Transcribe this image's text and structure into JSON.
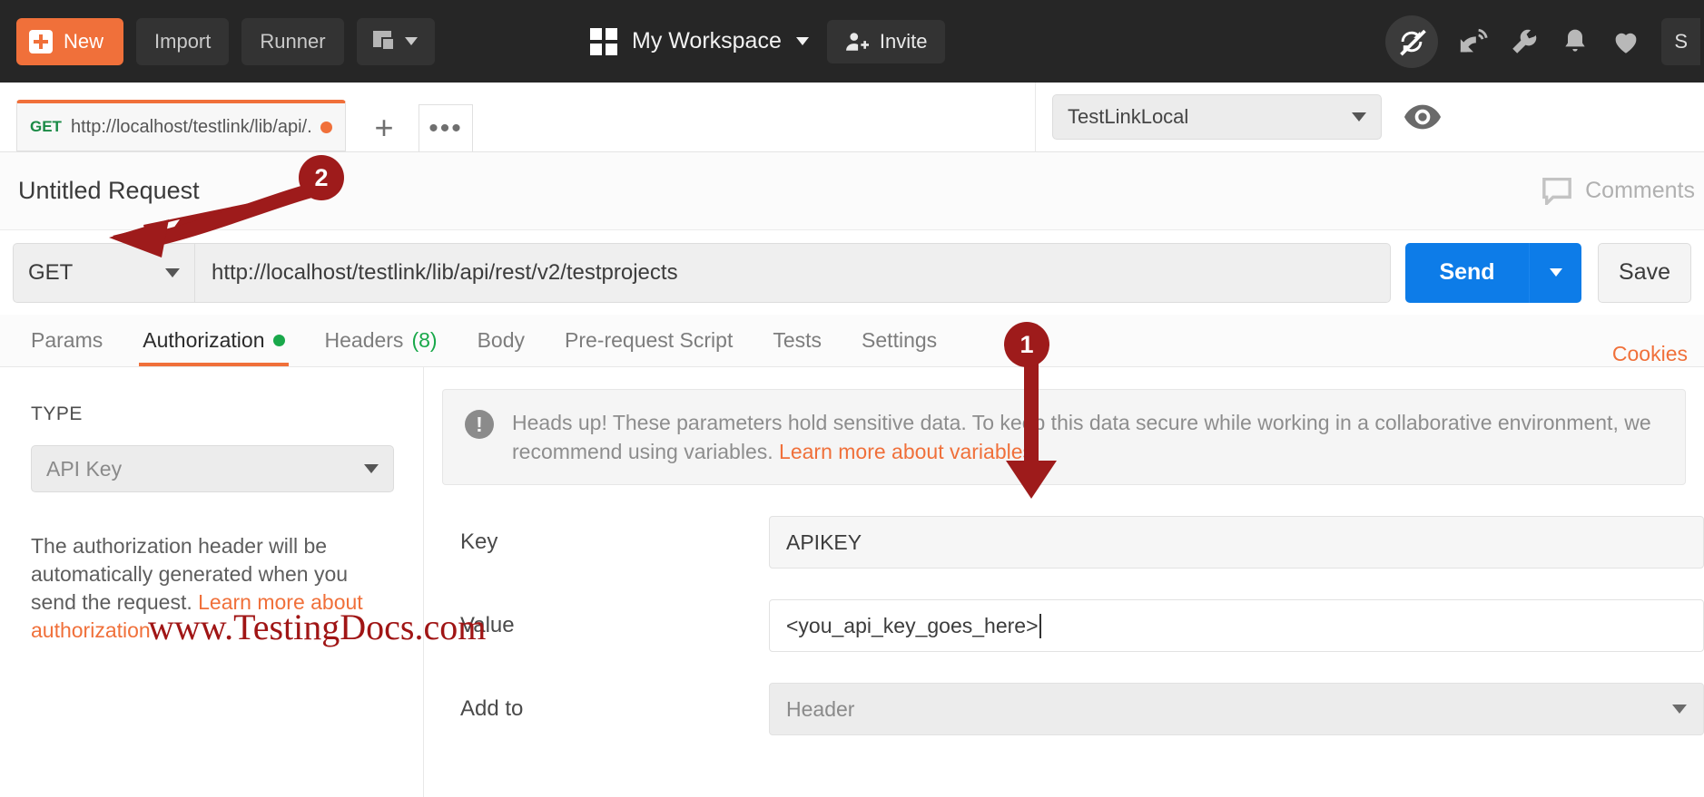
{
  "topbar": {
    "new_label": "New",
    "import_label": "Import",
    "runner_label": "Runner",
    "new_window_icon": "new-window-icon",
    "workspace_name": "My Workspace",
    "invite_label": "Invite",
    "signin_label": "S",
    "icons": [
      "sync-off-icon",
      "satellite-icon",
      "wrench-icon",
      "bell-icon",
      "heart-icon"
    ],
    "accent_color": "#f0703a",
    "bg_color": "#262626"
  },
  "tabs": {
    "request_tab": {
      "method": "GET",
      "url": "http://localhost/testlink/lib/api/...",
      "unsaved": true
    },
    "add_label": "+",
    "more_label": "•••"
  },
  "environment": {
    "selected": "TestLinkLocal",
    "eye_icon": "eye-icon"
  },
  "request": {
    "title": "Untitled Request",
    "comments_label": "Comments",
    "method": "GET",
    "url": "http://localhost/testlink/lib/api/rest/v2/testprojects",
    "send_label": "Send",
    "save_label": "Save"
  },
  "request_tabs": [
    {
      "label": "Params",
      "active": false,
      "badge": ""
    },
    {
      "label": "Authorization",
      "active": true,
      "badge": "dot"
    },
    {
      "label": "Headers",
      "active": false,
      "badge": "(8)"
    },
    {
      "label": "Body",
      "active": false,
      "badge": ""
    },
    {
      "label": "Pre-request Script",
      "active": false,
      "badge": ""
    },
    {
      "label": "Tests",
      "active": false,
      "badge": ""
    },
    {
      "label": "Settings",
      "active": false,
      "badge": ""
    }
  ],
  "cookies_label": "Cookies",
  "auth": {
    "type_label": "TYPE",
    "type_value": "API Key",
    "note_text_1": "The authorization header will be automatically generated when you send the request. ",
    "note_link": "Learn more about authorization",
    "notice_text_1": "Heads up! These parameters hold sensitive data. To keep this data secure while working in a collaborative environment, we recommend using variables. ",
    "notice_link": "Learn more about variables",
    "fields": [
      {
        "label": "Key",
        "value": "APIKEY",
        "style": "filled"
      },
      {
        "label": "Value",
        "value": "<you_api_key_goes_here>",
        "style": "plain"
      },
      {
        "label": "Add to",
        "value": "Header",
        "style": "select"
      }
    ]
  },
  "annotations": {
    "badge_one": "1",
    "badge_two": "2",
    "arrow_color": "#9e1b1b",
    "watermark": "www.TestingDocs.com"
  }
}
